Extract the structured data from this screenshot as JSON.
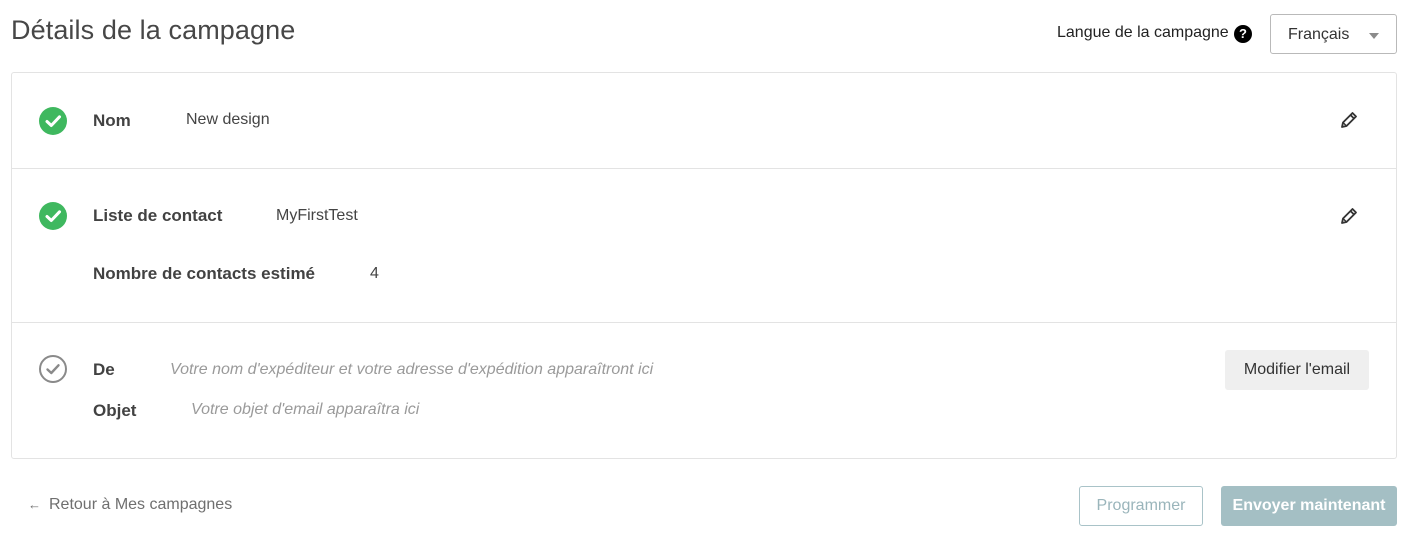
{
  "header": {
    "title": "Détails de la campagne",
    "language_label": "Langue de la campagne",
    "help_glyph": "?",
    "language_value": "Français"
  },
  "details": {
    "name": {
      "label": "Nom",
      "value": "New design",
      "status": "complete"
    },
    "contact_list": {
      "label": "Liste de contact",
      "value": "MyFirstTest",
      "status": "complete",
      "estimated_label": "Nombre de contacts estimé",
      "estimated_value": "4"
    },
    "sender": {
      "from_label": "De",
      "from_placeholder": "Votre nom d'expéditeur et votre adresse d'expédition apparaîtront ici",
      "subject_label": "Objet",
      "subject_placeholder": "Votre objet d'email apparaîtra ici",
      "status": "pending",
      "modify_button": "Modifier l'email"
    }
  },
  "footer": {
    "back_arrow": "←",
    "back_label": "Retour à Mes campagnes",
    "schedule_button": "Programmer",
    "send_button": "Envoyer maintenant"
  },
  "colors": {
    "success": "#3fb85f",
    "pending": "#8a8a8a",
    "primary_disabled": "#a4bfc4",
    "border": "#e3e3e3"
  },
  "icons": {
    "help": "help-icon",
    "dropdown": "chevron-down-icon",
    "edit": "pencil-icon",
    "complete": "check-circle-icon",
    "pending": "check-circle-outline-icon",
    "back": "arrow-left-icon"
  }
}
